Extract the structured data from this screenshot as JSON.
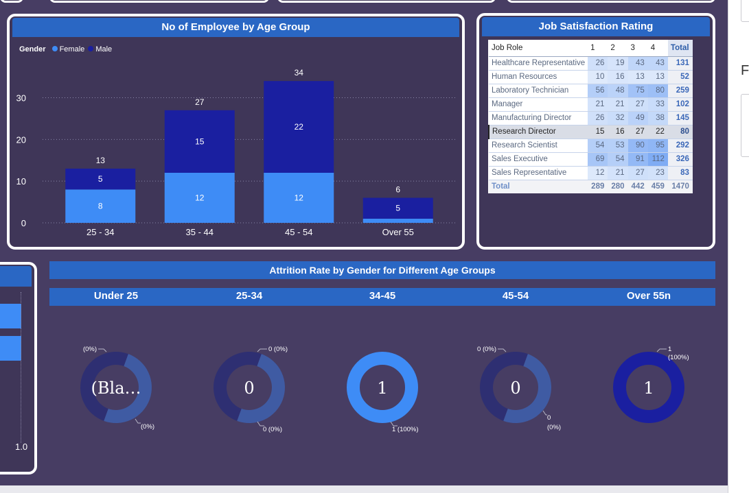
{
  "emp_chart": {
    "title": "No of Employee by Age Group",
    "legend": {
      "title": "Gender",
      "items": [
        {
          "name": "Female",
          "color": "#3e8cf6"
        },
        {
          "name": "Male",
          "color": "#1a1fa0"
        }
      ]
    },
    "y_ticks": [
      "0",
      "10",
      "20",
      "30"
    ]
  },
  "chart_data": {
    "type": "bar",
    "stacked": true,
    "title": "No of Employee by Age Group",
    "categories": [
      "25 - 34",
      "35 - 44",
      "45 - 54",
      "Over 55"
    ],
    "series": [
      {
        "name": "Female",
        "values": [
          8,
          12,
          12,
          1
        ],
        "labels": [
          "8",
          "12",
          "12",
          ""
        ],
        "color": "#3e8cf6"
      },
      {
        "name": "Male",
        "values": [
          5,
          15,
          22,
          5
        ],
        "labels": [
          "5",
          "15",
          "22",
          "5"
        ],
        "color": "#1a1fa0"
      }
    ],
    "totals": [
      13,
      27,
      34,
      6
    ],
    "ylim": [
      0,
      36
    ],
    "y_ticks": [
      0,
      10,
      20,
      30
    ],
    "grid": true,
    "legend_position": "top-left"
  },
  "job_satisfaction": {
    "title": "Job Satisfaction Rating",
    "headers": [
      "Job Role",
      "1",
      "2",
      "3",
      "4",
      "Total"
    ],
    "rows": [
      [
        "Healthcare Representative",
        "26",
        "19",
        "43",
        "43",
        "131"
      ],
      [
        "Human Resources",
        "10",
        "16",
        "13",
        "13",
        "52"
      ],
      [
        "Laboratory Technician",
        "56",
        "48",
        "75",
        "80",
        "259"
      ],
      [
        "Manager",
        "21",
        "21",
        "27",
        "33",
        "102"
      ],
      [
        "Manufacturing Director",
        "26",
        "32",
        "49",
        "38",
        "145"
      ],
      [
        "Research Director",
        "15",
        "16",
        "27",
        "22",
        "80"
      ],
      [
        "Research Scientist",
        "54",
        "53",
        "90",
        "95",
        "292"
      ],
      [
        "Sales Executive",
        "69",
        "54",
        "91",
        "112",
        "326"
      ],
      [
        "Sales Representative",
        "12",
        "21",
        "27",
        "23",
        "83"
      ]
    ],
    "selected_row": 5,
    "total_row": [
      "Total",
      "289",
      "280",
      "442",
      "459",
      "1470"
    ]
  },
  "attrition": {
    "title": "Attrition Rate by Gender for Different Age Groups",
    "groups": [
      {
        "label": "Under 25",
        "center": "(Bla…",
        "label_a": "(0%)",
        "label_b": "(0%)",
        "label_b2": "",
        "frac": 0.5,
        "color_main": "#2e2f72",
        "color_alt": "#3f5ba3"
      },
      {
        "label": "25-34",
        "center": "0",
        "label_a": "0 (0%)",
        "label_b": "0 (0%)",
        "label_b2": "",
        "frac": 0.5,
        "color_main": "#2e2f72",
        "color_alt": "#3f5ba3"
      },
      {
        "label": "34-45",
        "center": "1",
        "label_a": "",
        "label_b": "1 (100%)",
        "label_b2": "",
        "frac": 1.0,
        "color_main": "#3e8cf6",
        "color_alt": "#3e8cf6"
      },
      {
        "label": "45-54",
        "center": "0",
        "label_a": "0 (0%)",
        "label_b": "0",
        "label_b2": "(0%)",
        "frac": 0.5,
        "color_main": "#2e2f72",
        "color_alt": "#3f5ba3"
      },
      {
        "label": "Over 55n",
        "center": "1",
        "label_a": "1",
        "label_a2": "(100%)",
        "label_b": "",
        "label_b2": "",
        "frac": 1.0,
        "color_main": "#1a1fa0",
        "color_alt": "#1a1fa0"
      }
    ]
  },
  "left_visual": {
    "value_label": "1.0"
  },
  "right_pane": {
    "letter": "F"
  }
}
